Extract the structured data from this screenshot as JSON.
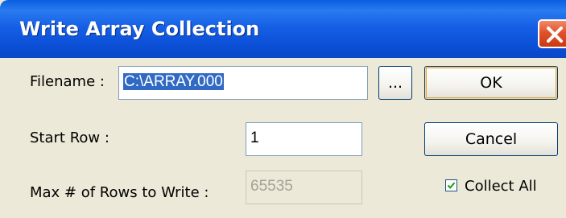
{
  "window": {
    "title": "Write Array Collection"
  },
  "form": {
    "filename_label": "Filename :",
    "filename_value": "C:\\ARRAY.000",
    "browse_label": "...",
    "start_row_label": "Start Row :",
    "start_row_value": "1",
    "max_rows_label": "Max # of Rows to Write :",
    "max_rows_value": "65535"
  },
  "buttons": {
    "ok_label": "OK",
    "cancel_label": "Cancel"
  },
  "options": {
    "collect_all_label": "Collect All",
    "collect_all_checked": true
  },
  "colors": {
    "titlebar": "#0b4fd6",
    "dialog_bg": "#ece9d8",
    "selection": "#316ac5",
    "close_button": "#e2522a"
  },
  "icons": {
    "close": "close-icon",
    "check": "checkmark-icon"
  }
}
